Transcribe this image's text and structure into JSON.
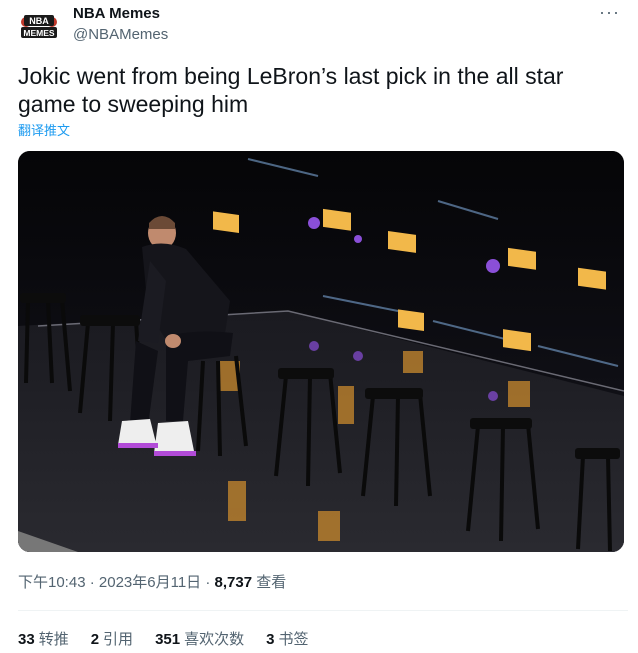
{
  "author": {
    "display_name": "NBA Memes",
    "handle": "@NBAMemes",
    "avatar_text_top": "NBA",
    "avatar_text_bottom": "MEMES"
  },
  "more_icon": "more-dots-icon",
  "tweet": {
    "text": "Jokic went from being LeBron’s last pick in the all star game to sweeping him",
    "translate_label": "翻译推文"
  },
  "meta": {
    "time": "下午10:43",
    "separator": "·",
    "date": "2023年6月11日",
    "views_count": "8,737",
    "views_label": "查看"
  },
  "stats": [
    {
      "count": "33",
      "label": "转推"
    },
    {
      "count": "2",
      "label": "引用"
    },
    {
      "count": "351",
      "label": "喜欢次数"
    },
    {
      "count": "3",
      "label": "书签"
    }
  ],
  "colors": {
    "text": "#0f1419",
    "secondary": "#536471",
    "link": "#1d9bf0",
    "divider": "#eff3f4"
  }
}
